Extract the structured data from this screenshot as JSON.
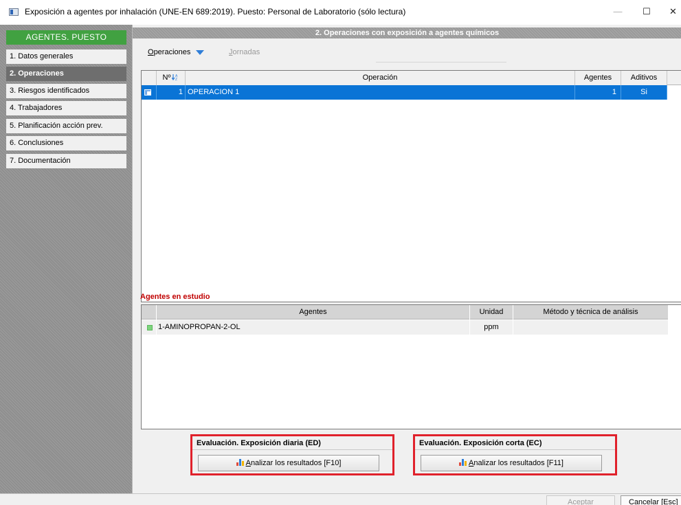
{
  "window": {
    "title": "Exposición a agentes por inhalación (UNE-EN 689:2019). Puesto: Personal de Laboratorio  (sólo lectura)",
    "minimize": "—",
    "maximize": "☐",
    "close": "✕"
  },
  "sidebar": {
    "header": "AGENTES. PUESTO",
    "items": [
      {
        "label": "1. Datos generales",
        "active": false
      },
      {
        "label": "2. Operaciones",
        "active": true
      },
      {
        "label": "3. Riesgos identificados",
        "active": false
      },
      {
        "label": "4. Trabajadores",
        "active": false
      },
      {
        "label": "5. Planificación acción prev.",
        "active": false
      },
      {
        "label": "6. Conclusiones",
        "active": false
      },
      {
        "label": "7. Documentación",
        "active": false
      }
    ]
  },
  "main": {
    "section_title": "2. Operaciones con exposición a agentes químicos",
    "toolbar": {
      "operaciones_first": "O",
      "operaciones_rest": "peraciones",
      "jornadas_first": "J",
      "jornadas_rest": "ornadas"
    },
    "operations_table": {
      "columns": [
        "Nº",
        "Operación",
        "Agentes",
        "Aditivos"
      ],
      "rows": [
        {
          "num": "1",
          "operacion": "OPERACION 1",
          "agentes": "1",
          "aditivos": "Si"
        }
      ]
    },
    "agents_section_label": "Agentes en estudio",
    "agents_table": {
      "columns": [
        "Agentes",
        "Unidad",
        "Método y técnica de análisis"
      ],
      "rows": [
        {
          "agente": "1-AMINOPROPAN-2-OL",
          "unidad": "ppm",
          "metodo": ""
        }
      ]
    },
    "eval_ed": {
      "title": "Evaluación. Exposición diaria (ED)",
      "button_first": "A",
      "button_rest": "nalizar los resultados  [F10]"
    },
    "eval_ec": {
      "title": "Evaluación. Exposición corta  (EC)",
      "button_first": "A",
      "button_rest": "nalizar los resultados  [F11]"
    }
  },
  "footer": {
    "accept": "Aceptar",
    "cancel": "Cancelar  [Esc]"
  },
  "colors": {
    "selection": "#0a74d6",
    "sidebar_header": "#41a141",
    "highlight_border": "#e0212b",
    "section_label": "#c00000"
  }
}
